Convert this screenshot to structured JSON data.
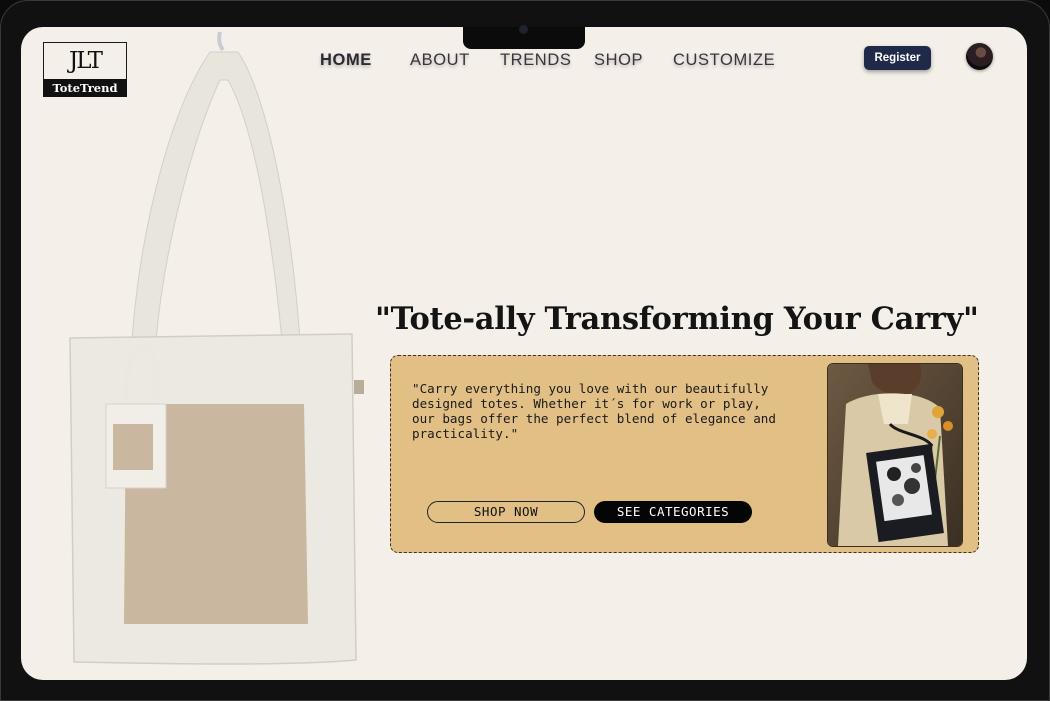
{
  "brand": {
    "mark": "JLT",
    "name": "ToteTrend"
  },
  "nav": {
    "items": [
      {
        "label": "HOME",
        "active": true
      },
      {
        "label": "ABOUT",
        "active": false
      },
      {
        "label": "TRENDS",
        "active": false
      },
      {
        "label": "SHOP",
        "active": false
      },
      {
        "label": "CUSTOMIZE",
        "active": false
      }
    ],
    "register_label": "Register"
  },
  "hero": {
    "headline": "\"Tote-ally Transforming Your Carry\"",
    "description": "\"Carry everything you love with our beautifully\ndesigned totes. Whether it´s for work or play,\nour bags offer the perfect blend of elegance and\npracticality.\"",
    "shop_now_label": "SHOP NOW",
    "see_categories_label": "SEE CATEGORIES"
  },
  "colors": {
    "background": "#f4f0e9",
    "card": "#e2c085",
    "register_button": "#1f2a4a",
    "bag_canvas": "#ece9e2",
    "bag_pocket": "#c9b7a0"
  },
  "icons": [
    "avatar",
    "camera"
  ]
}
